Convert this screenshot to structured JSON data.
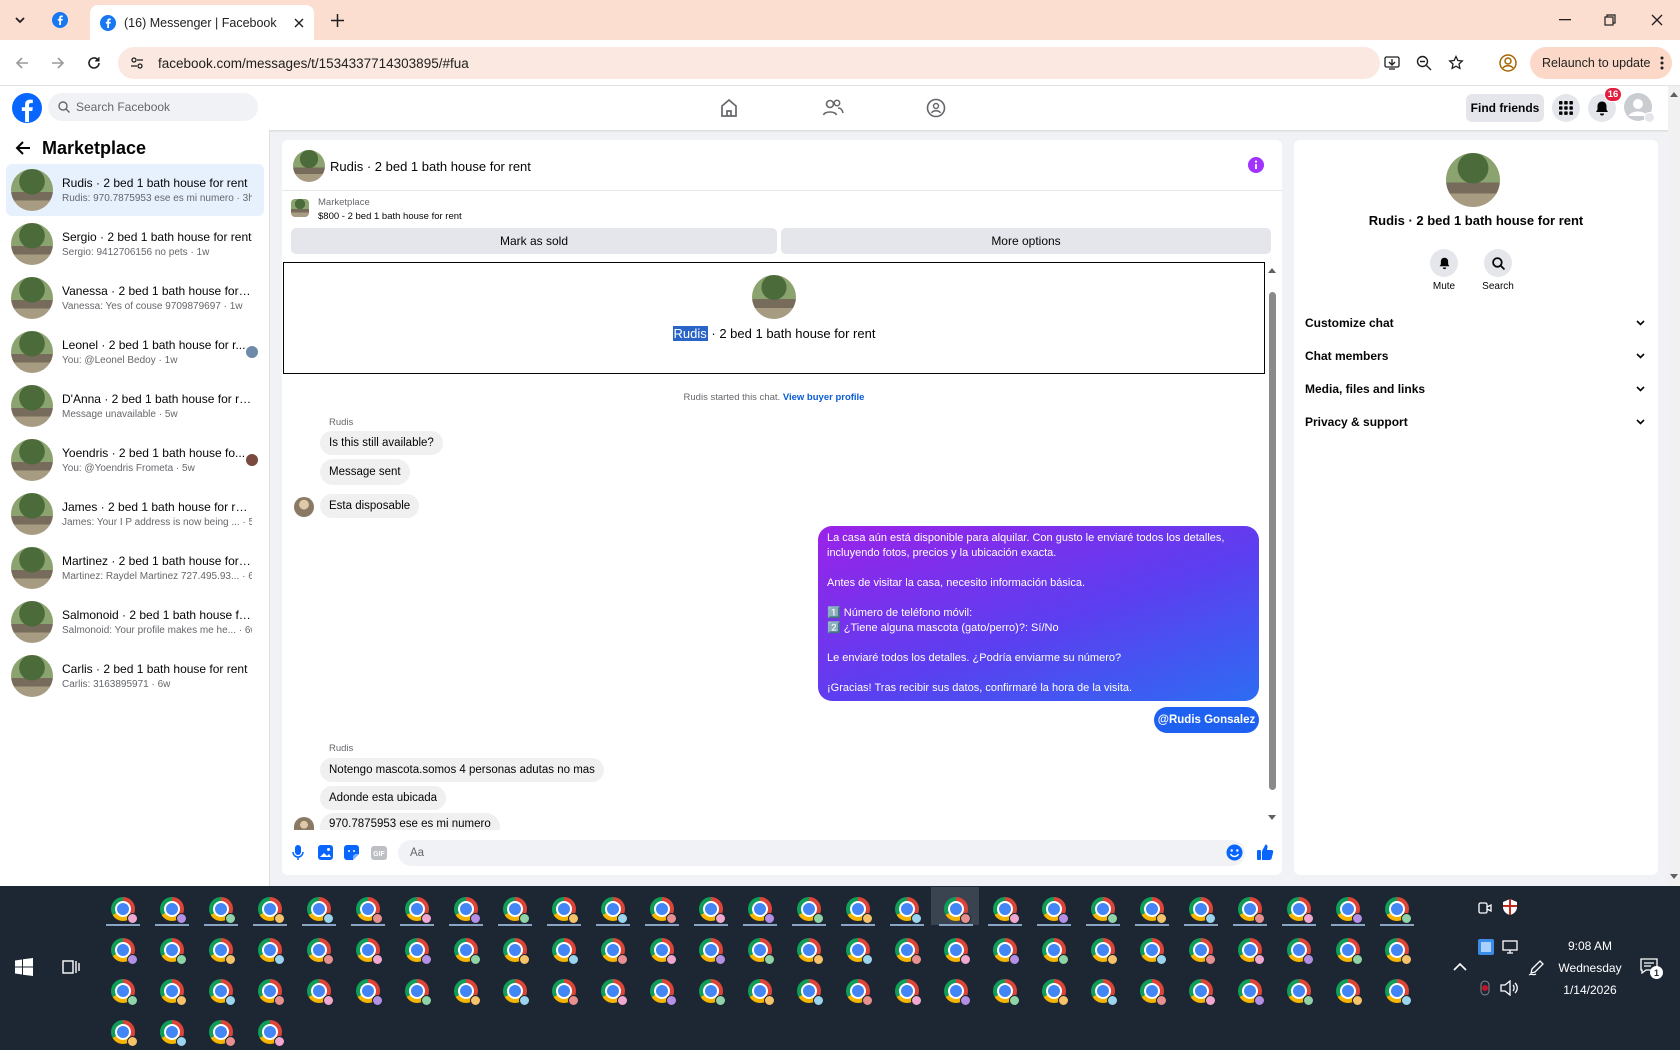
{
  "browser": {
    "tab_title": "(16) Messenger | Facebook",
    "url": "facebook.com/messages/t/1534337714303895/#fua",
    "relaunch_label": "Relaunch to update"
  },
  "fb": {
    "search_placeholder": "Search Facebook",
    "find_friends": "Find friends",
    "notif_count": "16"
  },
  "sidebar": {
    "title": "Marketplace",
    "conversations": [
      {
        "name": "Rudis · 2 bed 1 bath house for rent",
        "preview": "Rudis: 970.7875953 ese es mi numero · 3h"
      },
      {
        "name": "Sergio · 2 bed 1 bath house for rent",
        "preview": "Sergio: 9412706156 no pets · 1w"
      },
      {
        "name": "Vanessa · 2 bed 1 bath house for re...",
        "preview": "Vanessa: Yes of couse 9709879697 · 1w"
      },
      {
        "name": "Leonel · 2 bed 1 bath house for r...",
        "preview": "You: @Leonel Bedoy · 1w"
      },
      {
        "name": "D'Anna · 2 bed 1 bath house for rent",
        "preview": "Message unavailable · 5w"
      },
      {
        "name": "Yoendris · 2 bed 1 bath house fo...",
        "preview": "You: @Yoendris Frometa · 5w"
      },
      {
        "name": "James · 2 bed 1 bath house for rent",
        "preview": "James: Your I P address is now being ... · 5w"
      },
      {
        "name": "Martinez · 2 bed 1 bath house for r...",
        "preview": "Martinez: Raydel Martinez 727.495.93... · 6w"
      },
      {
        "name": "Salmonoid · 2 bed 1 bath house fo...",
        "preview": "Salmonoid: Your profile makes me he... · 6w"
      },
      {
        "name": "Carlis · 2 bed 1 bath house for rent",
        "preview": "Carlis: 3163895971 · 6w"
      }
    ]
  },
  "chat": {
    "header_title": "Rudis · 2 bed 1 bath house for rent",
    "listing_label": "Marketplace",
    "listing_price": "$800 - 2 bed 1 bath house for rent",
    "mark_sold": "Mark as sold",
    "more_options": "More options",
    "intro_name": "Rudis",
    "intro_rest": " · 2 bed 1 bath house for rent",
    "started_text": "Rudis started this chat.",
    "view_profile": "View buyer profile",
    "sender_name": "Rudis",
    "msg1": "Is this still available?",
    "msg2": "Message sent",
    "msg3": "Esta disposable",
    "sent_lines": [
      "La casa aún está disponible para alquilar. Con gusto le enviaré todos los detalles,",
      "incluyendo fotos, precios y la ubicación exacta.",
      "",
      "Antes de visitar la casa, necesito información básica.",
      "",
      "1️⃣ Número de teléfono móvil:",
      "2️⃣ ¿Tiene alguna mascota (gato/perro)?: Sí/No",
      "",
      "Le enviaré todos los detalles. ¿Podría enviarme su número?",
      "",
      "¡Gracias! Tras recibir sus datos, confirmaré la hora de la visita."
    ],
    "mention": "@Rudis Gonsalez",
    "sender_name2": "Rudis",
    "msg4": "Notengo  mascota.somos 4 personas adutas no mas",
    "msg5": "Adonde  esta  ubicada",
    "msg6": "970.7875953  ese es mi numero",
    "composer_placeholder": "Aa"
  },
  "details": {
    "title": "Rudis · 2 bed 1 bath house for rent",
    "mute": "Mute",
    "search": "Search",
    "sections": [
      "Customize chat",
      "Chat members",
      "Media, files and links",
      "Privacy & support"
    ]
  },
  "taskbar": {
    "time": "9:08 AM",
    "day": "Wednesday",
    "date": "1/14/2026",
    "notif_count": "1"
  }
}
